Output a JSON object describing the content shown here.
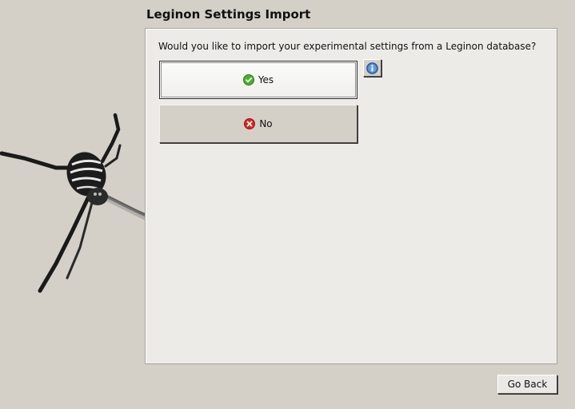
{
  "page": {
    "title": "Leginon Settings Import"
  },
  "question": {
    "text": "Would you like to import your experimental settings from a Leginon database?"
  },
  "choices": {
    "yes_label": "Yes",
    "no_label": "No"
  },
  "footer": {
    "back_label": "Go Back"
  },
  "icons": {
    "yes": "check-circle-icon",
    "no": "x-circle-icon",
    "info": "info-icon",
    "decoration": "spider-icon"
  },
  "colors": {
    "window_bg": "#d4d0c8",
    "panel_bg": "#edebe7",
    "yes_icon": "#4caf2e",
    "no_icon": "#d9231e",
    "info_icon": "#3a78c9"
  }
}
